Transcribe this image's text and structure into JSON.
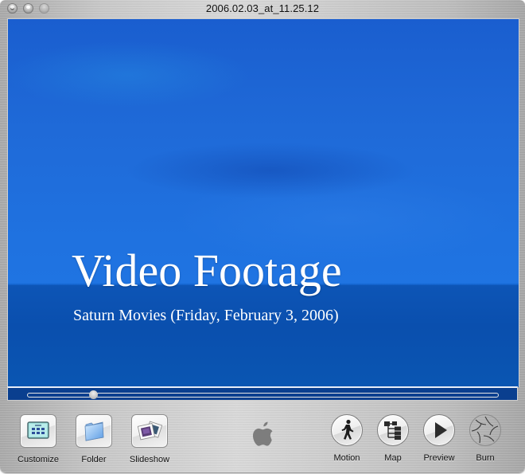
{
  "window": {
    "title": "2006.02.03_at_11.25.12",
    "controls": [
      {
        "name": "close",
        "icon": "close-icon"
      },
      {
        "name": "minimize",
        "icon": "minimize-icon"
      },
      {
        "name": "zoom",
        "icon": "zoom-icon"
      }
    ]
  },
  "preview": {
    "heading": "Video Footage",
    "subheading": "Saturn Movies (Friday, February 3, 2006)",
    "colors": {
      "sky": "#1f6ad8",
      "sea": "#0a4fae",
      "scrubbar": "#0a3f8f"
    }
  },
  "scrubber": {
    "position_fraction": 0.14
  },
  "toolbar": {
    "left_buttons": [
      {
        "id": "customize",
        "label": "Customize",
        "icon": "customize-icon"
      },
      {
        "id": "folder",
        "label": "Folder",
        "icon": "folder-icon"
      },
      {
        "id": "slideshow",
        "label": "Slideshow",
        "icon": "slideshow-icon"
      }
    ],
    "logo": "apple-logo-icon",
    "right_buttons": [
      {
        "id": "motion",
        "label": "Motion",
        "icon": "walking-person-icon"
      },
      {
        "id": "map",
        "label": "Map",
        "icon": "map-tree-icon"
      },
      {
        "id": "preview",
        "label": "Preview",
        "icon": "play-icon"
      },
      {
        "id": "burn",
        "label": "Burn",
        "icon": "burn-aperture-icon"
      }
    ]
  }
}
